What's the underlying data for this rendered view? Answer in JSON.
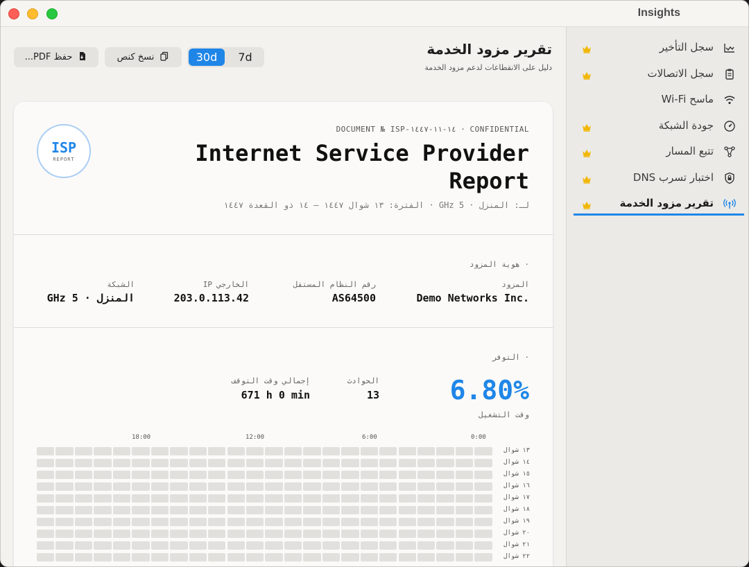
{
  "window": {
    "title": "Insights"
  },
  "sidebar": {
    "items": [
      {
        "label": "سجل التأخير",
        "icon": "latency-chart-icon",
        "premium": true,
        "active": false
      },
      {
        "label": "سجل الاتصالات",
        "icon": "clipboard-icon",
        "premium": true,
        "active": false
      },
      {
        "label": "ماسح Wi-Fi",
        "icon": "wifi-icon",
        "premium": false,
        "active": false
      },
      {
        "label": "جودة الشبكة",
        "icon": "gauge-icon",
        "premium": true,
        "active": false
      },
      {
        "label": "تتبع المسار",
        "icon": "route-icon",
        "premium": true,
        "active": false
      },
      {
        "label": "اختبار تسرب DNS",
        "icon": "shield-icon",
        "premium": true,
        "active": false
      },
      {
        "label": "تقرير مزود الخدمة",
        "icon": "antenna-icon",
        "premium": true,
        "active": true
      }
    ]
  },
  "header": {
    "title": "تقرير مزود الخدمة",
    "subtitle": "دليل على الانقطاعات لدعم مزود الخدمة"
  },
  "toolbar": {
    "save_pdf": "حفظ PDF...",
    "copy_text": "نسخ كنص",
    "range_30d": "30d",
    "range_7d": "7d",
    "selected_range": "30d"
  },
  "report": {
    "doc_number": "DOCUMENT № ISP-١٤-١١-١٤٤٧ · CONFIDENTIAL",
    "title": "Internet Service Provider Report",
    "meta": "لـ: المنزل · 5 GHz · الفترة: ١٣ شوال ١٤٤٧ — ١٤ ذو القعدة ١٤٤٧",
    "badge_main": "ISP",
    "badge_sub": "REPORT",
    "identity": {
      "section": "· هوية المزود",
      "provider_label": "المزود",
      "provider_value": "Demo Networks Inc.",
      "asn_label": "رقم النظام المستقل",
      "asn_value": "AS64500",
      "ip_label": "الخارجي IP",
      "ip_value": "203.0.113.42",
      "network_label": "الشبكة",
      "network_value": "المنزل · 5 GHz"
    },
    "availability": {
      "section": "· التوفر",
      "uptime_value": "6.80%",
      "uptime_label": "وقت التشغيل",
      "incidents_label": "الحوادث",
      "incidents_value": "13",
      "downtime_label": "إجمالي وقت التوقف",
      "downtime_value": "671 h 0 min"
    },
    "heatmap": {
      "hour_labels": [
        "0:00",
        "6:00",
        "12:00",
        "18:00"
      ],
      "day_labels": [
        "١٣ شوال",
        "١٤ شوال",
        "١٥ شوال",
        "١٦ شوال",
        "١٧ شوال",
        "١٨ شوال",
        "١٩ شوال",
        "٢٠ شوال",
        "٢١ شوال",
        "٢٢ شوال"
      ],
      "cell_color": "#e2e0dc"
    }
  },
  "colors": {
    "accent": "#1f86e8",
    "crown": "#f2b705"
  }
}
